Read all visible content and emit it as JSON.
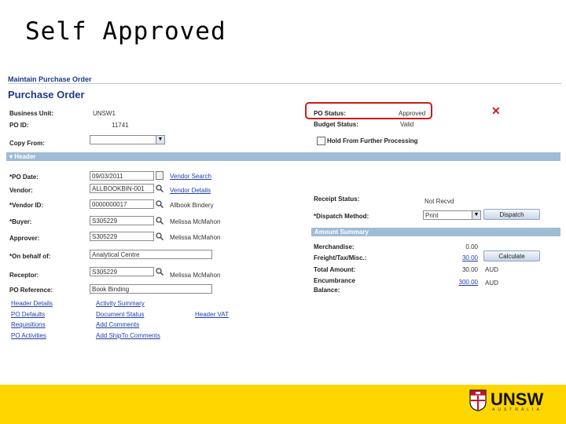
{
  "slide": {
    "title": "Self Approved"
  },
  "breadcrumb": "Maintain Purchase Order",
  "page_title": "Purchase Order",
  "left_top": {
    "business_unit_label": "Business Unit:",
    "business_unit_value": "UNSW1",
    "po_id_label": "PO ID:",
    "po_id_value": "11741",
    "copy_from_label": "Copy From:",
    "copy_from_value": ""
  },
  "right_top": {
    "po_status_label": "PO Status:",
    "po_status_value": "Approved",
    "budget_status_label": "Budget Status:",
    "budget_status_value": "Valid",
    "hold_label": "Hold From Further Processing"
  },
  "header_bar": "Header",
  "header_fields": {
    "po_date_label": "*PO Date:",
    "po_date_value": "09/03/2011",
    "vendor_label": "Vendor:",
    "vendor_value": "ALLBOOKBIN-001",
    "vendor_id_label": "*Vendor ID:",
    "vendor_id_value": "0000000017",
    "buyer_label": "*Buyer:",
    "buyer_value": "S305229",
    "approver_label": "Approver:",
    "approver_value": "S305229",
    "on_behalf_label": "*On behalf of:",
    "on_behalf_value": "Analytical Centre",
    "receptor_label": "Receptor:",
    "receptor_value": "S305229",
    "po_reference_label": "PO Reference:",
    "po_reference_value": "Book Binding"
  },
  "side_links": {
    "vendor_search": "Vendor Search",
    "vendor_details": "Vendor Details",
    "vendor_name": "Allbook Bindery",
    "buyer_name": "Melissa McMahon",
    "approver_name": "Melissa McMahon",
    "receptor_name": "Melissa McMahon"
  },
  "receipt": {
    "receipt_status_label": "Receipt Status:",
    "receipt_status_value": "Not Recvd",
    "dispatch_method_label": "*Dispatch Method:",
    "dispatch_method_value": "Print",
    "dispatch_button": "Dispatch"
  },
  "amount_summary": {
    "bar_label": "Amount Summary",
    "merchandise_label": "Merchandise:",
    "merchandise_value": "0.00",
    "freight_label": "Freight/Tax/Misc.:",
    "freight_value": "30.00",
    "total_label": "Total Amount:",
    "total_value": "30.00",
    "currency": "AUD",
    "calculate_button": "Calculate",
    "encumbrance_label": "Encumbrance Balance:",
    "encumbrance_value": "300.00",
    "encumbrance_currency": "AUD"
  },
  "bottom_links": {
    "col1": [
      "Header Details",
      "PO Defaults",
      "Requisitions",
      "PO Activities"
    ],
    "col2": [
      "Activity Summary",
      "Document Status",
      "Add Comments",
      "Add ShipTo Comments"
    ],
    "col3": [
      "Header VAT"
    ]
  },
  "brand": {
    "name": "UNSW",
    "sub": "AUSTRALIA",
    "footer_color": "#ffd600",
    "status_highlight": "#cc1b1b"
  }
}
